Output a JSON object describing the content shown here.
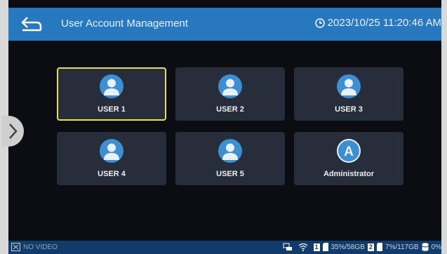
{
  "header": {
    "title": "User Account Management",
    "datetime": "2023/10/25 11:20:46 AM",
    "back_icon": "back-arrow-icon",
    "clock_icon": "clock-icon"
  },
  "users": [
    {
      "label": "USER 1",
      "selected": true
    },
    {
      "label": "USER 2"
    },
    {
      "label": "USER 3"
    },
    {
      "label": "USER 4"
    },
    {
      "label": "USER 5"
    },
    {
      "label": "Administrator",
      "icon": "admin-a-icon"
    }
  ],
  "status": {
    "video": "NO VIDEO",
    "disk1_num": "1",
    "disk1": "35%/58GB",
    "disk2_num": "2",
    "disk2": "7%/117GB",
    "disk3": "0%"
  },
  "colors": {
    "header": "#2878c0",
    "tile": "#272d3b",
    "selected_border": "#e8e34a",
    "statusbar": "#113b6a"
  }
}
